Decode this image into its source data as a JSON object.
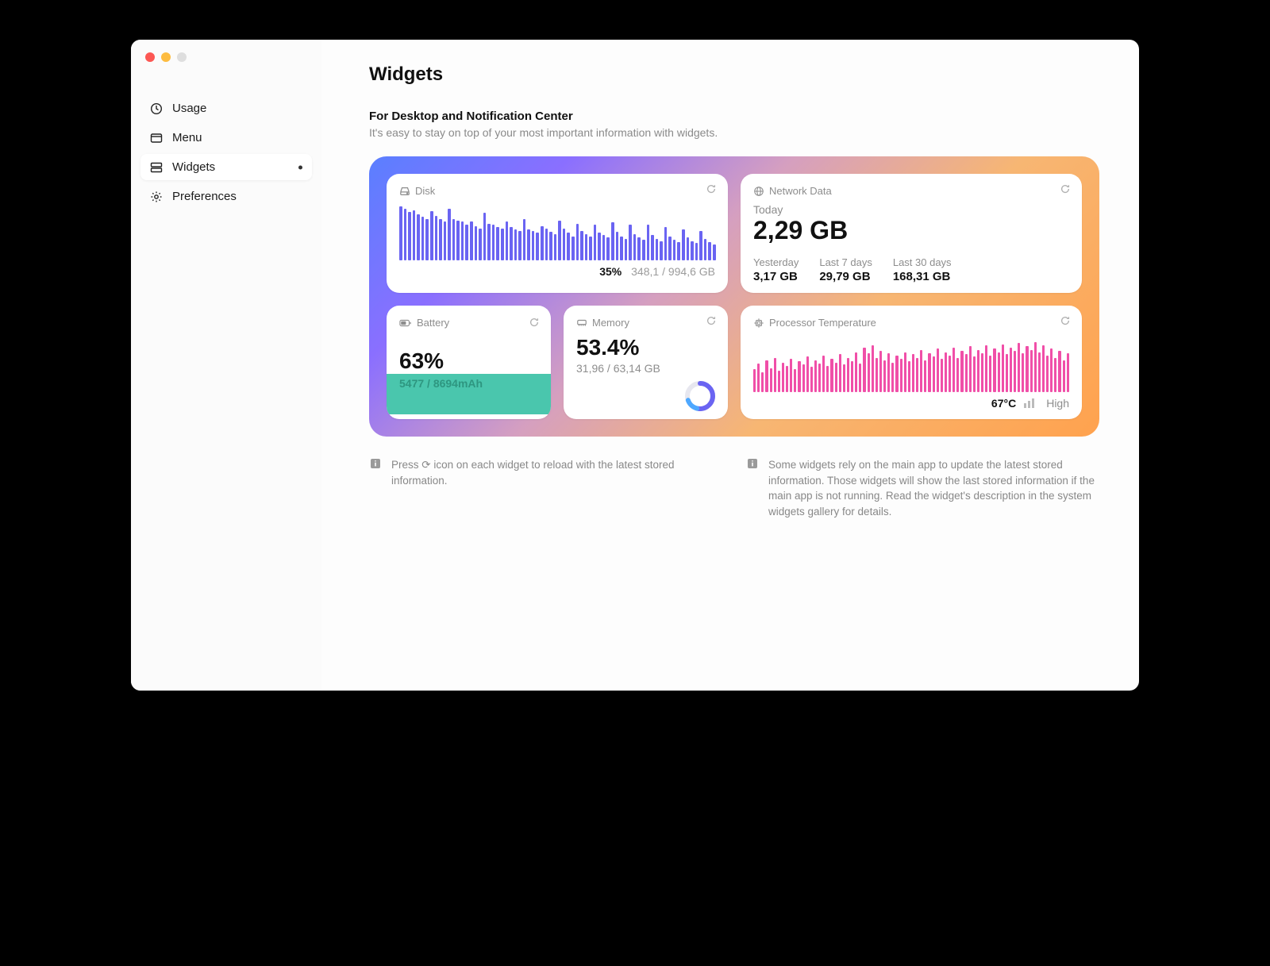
{
  "sidebar": {
    "items": [
      {
        "label": "Usage"
      },
      {
        "label": "Menu"
      },
      {
        "label": "Widgets"
      },
      {
        "label": "Preferences"
      }
    ]
  },
  "page": {
    "title": "Widgets",
    "subtitle": "For Desktop and Notification Center",
    "subdesc": "It's easy to stay on top of your most important information with widgets."
  },
  "widgets": {
    "disk": {
      "title": "Disk",
      "percent": "35%",
      "detail": "348,1 / 994,6 GB",
      "bars": [
        95,
        90,
        85,
        88,
        80,
        76,
        72,
        86,
        78,
        72,
        68,
        90,
        72,
        70,
        68,
        62,
        68,
        60,
        56,
        84,
        64,
        62,
        58,
        55,
        68,
        58,
        54,
        52,
        72,
        54,
        52,
        48,
        60,
        56,
        50,
        46,
        70,
        56,
        48,
        42,
        64,
        52,
        46,
        42,
        62,
        48,
        44,
        40,
        66,
        50,
        42,
        38,
        62,
        46,
        40,
        36,
        62,
        44,
        38,
        34,
        58,
        42,
        36,
        32,
        54,
        40,
        34,
        30,
        52,
        38,
        32,
        28
      ]
    },
    "network": {
      "title": "Network Data",
      "today_label": "Today",
      "today": "2,29 GB",
      "stats": [
        {
          "label": "Yesterday",
          "value": "3,17 GB"
        },
        {
          "label": "Last 7 days",
          "value": "29,79 GB"
        },
        {
          "label": "Last 30 days",
          "value": "168,31 GB"
        }
      ]
    },
    "battery": {
      "title": "Battery",
      "percent": "63%",
      "detail": "5477 / 8694mAh"
    },
    "memory": {
      "title": "Memory",
      "percent": "53.4%",
      "detail": "31,96 / 63,14 GB"
    },
    "processor": {
      "title": "Processor Temperature",
      "temp": "67°C",
      "status": "High",
      "bars": [
        40,
        50,
        35,
        55,
        42,
        60,
        38,
        52,
        46,
        58,
        40,
        54,
        48,
        62,
        44,
        56,
        50,
        64,
        46,
        58,
        52,
        66,
        48,
        60,
        54,
        70,
        50,
        78,
        68,
        82,
        60,
        72,
        56,
        68,
        52,
        64,
        58,
        70,
        54,
        66,
        60,
        74,
        56,
        68,
        62,
        76,
        58,
        70,
        64,
        78,
        60,
        72,
        66,
        80,
        62,
        74,
        68,
        82,
        64,
        76,
        70,
        84,
        66,
        78,
        72,
        86,
        68,
        80,
        74,
        88,
        70,
        82,
        64,
        76,
        60,
        72,
        56,
        68
      ]
    }
  },
  "notes": {
    "a": "Press ⟳ icon on each widget to reload with the latest stored information.",
    "b": "Some widgets rely on the main app to update the latest stored information. Those widgets will show the last stored information if the main app is not running. Read the widget's description in the system widgets gallery for details."
  }
}
